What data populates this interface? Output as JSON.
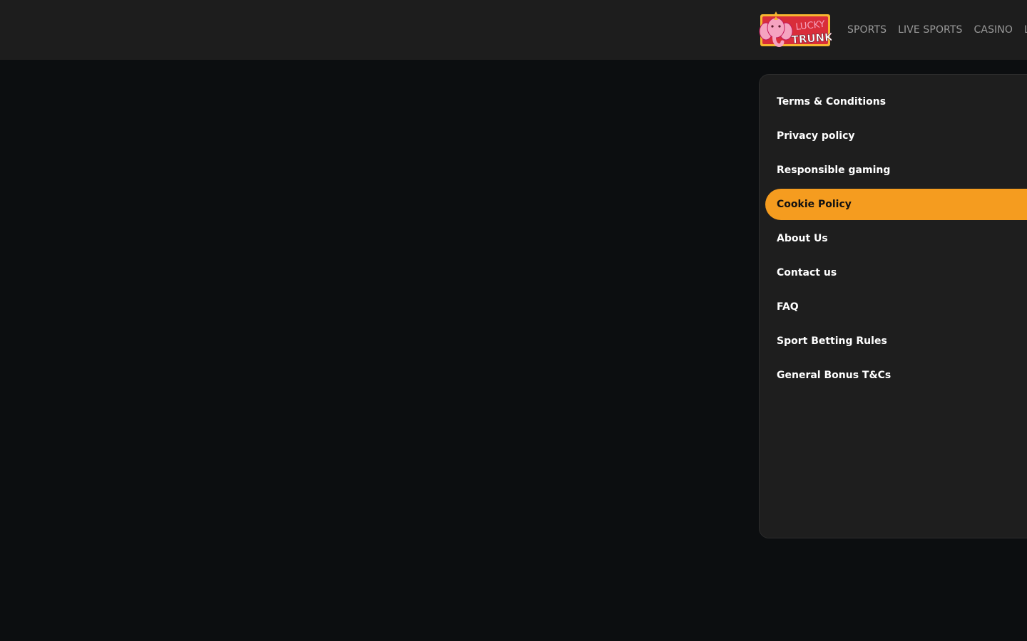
{
  "header": {
    "logo_icon": "lucky-trunk-elephant-logo",
    "logo_text": [
      "LUCKY",
      "TRUNK"
    ],
    "nav": [
      {
        "label": "SPORTS"
      },
      {
        "label": "LIVE SPORTS"
      },
      {
        "label": "CASINO"
      },
      {
        "label": "L"
      }
    ]
  },
  "sidebar": {
    "active_index": 3,
    "items": [
      {
        "label": "Terms & Conditions"
      },
      {
        "label": "Privacy policy"
      },
      {
        "label": "Responsible gaming"
      },
      {
        "label": "Cookie Policy"
      },
      {
        "label": "About Us"
      },
      {
        "label": "Contact us"
      },
      {
        "label": "FAQ"
      },
      {
        "label": "Sport Betting Rules"
      },
      {
        "label": "General Bonus T&Cs"
      }
    ]
  },
  "colors": {
    "page_bg": "#0c0e10",
    "header_bg": "#1d1d1d",
    "panel_bg": "#1e1e1e",
    "accent": "#f59c1f",
    "logo_red": "#d92d3a",
    "logo_pink": "#f5a3c0"
  }
}
